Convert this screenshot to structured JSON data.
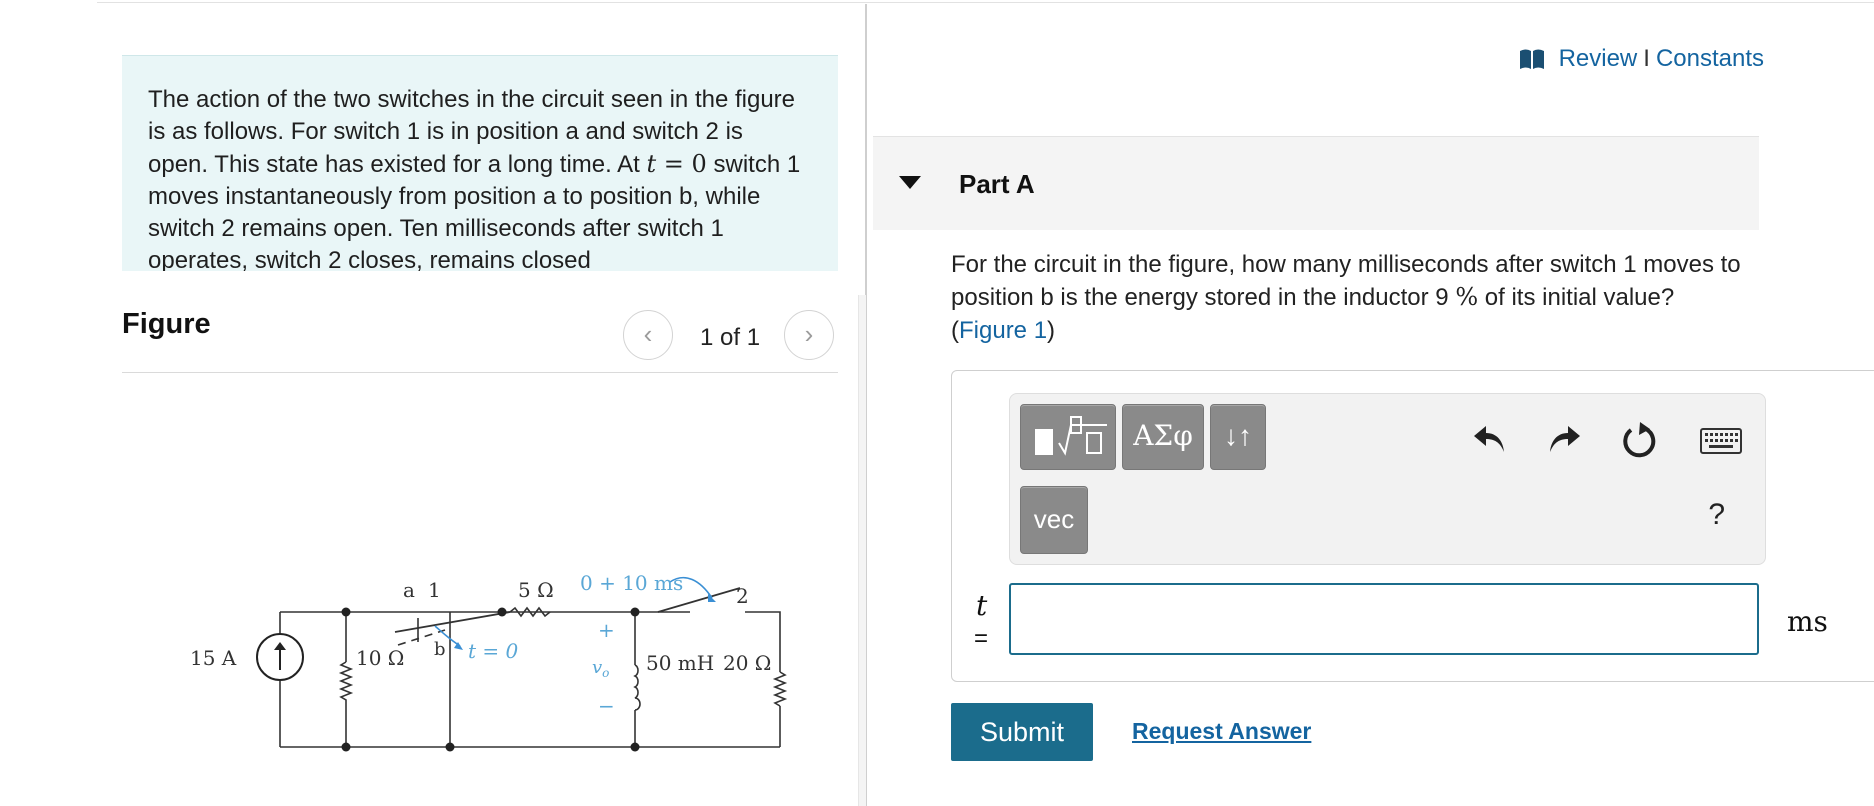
{
  "problem": {
    "intro_1": "The action of the two switches in the circuit seen in the figure is as follows. For switch 1 is in position a and switch 2 is open. This state has existed for a long time. At ",
    "intro_math": "t",
    "intro_eq": " = 0",
    "intro_2": " switch 1 moves instantaneously from position a to position b, while switch 2 remains open. Ten milliseconds after switch 1 operates, switch 2 closes, remains closed"
  },
  "figure": {
    "title": "Figure",
    "pager": "1 of 1",
    "labels": {
      "source": "15 A",
      "r1": "10 Ω",
      "a": "a",
      "one": "1",
      "b": "b",
      "t0": "t = 0",
      "r2": "5 Ω",
      "ts2": "0 + 10 ms",
      "two": "2",
      "plus": "+",
      "vo": "v",
      "vo_sub": "o",
      "minus": "−",
      "inductor": "50 mH",
      "r3": "20 Ω"
    }
  },
  "header": {
    "review": "Review",
    "separator": "I",
    "constants": "Constants"
  },
  "part": {
    "title": "Part A",
    "question_pre": "For the circuit in the figure, how many milliseconds after switch 1 moves to position b is the energy stored in the inductor 9 ",
    "percent": "%",
    "question_post": " of its initial value?(",
    "figure_link": "Figure 1",
    "question_close": ")"
  },
  "toolbar": {
    "greek_label": "ΑΣφ",
    "arrows_label": "↓↑",
    "vec_label": "vec",
    "help_label": "?"
  },
  "answer": {
    "variable": "t",
    "equals": "=",
    "value": "",
    "unit": "ms"
  },
  "actions": {
    "submit": "Submit",
    "request": "Request Answer"
  },
  "colors": {
    "accent": "#1b6c8c",
    "link": "#1464a0",
    "intro_bg": "#e9f6f7",
    "figure_label": "#5aa7d6"
  }
}
